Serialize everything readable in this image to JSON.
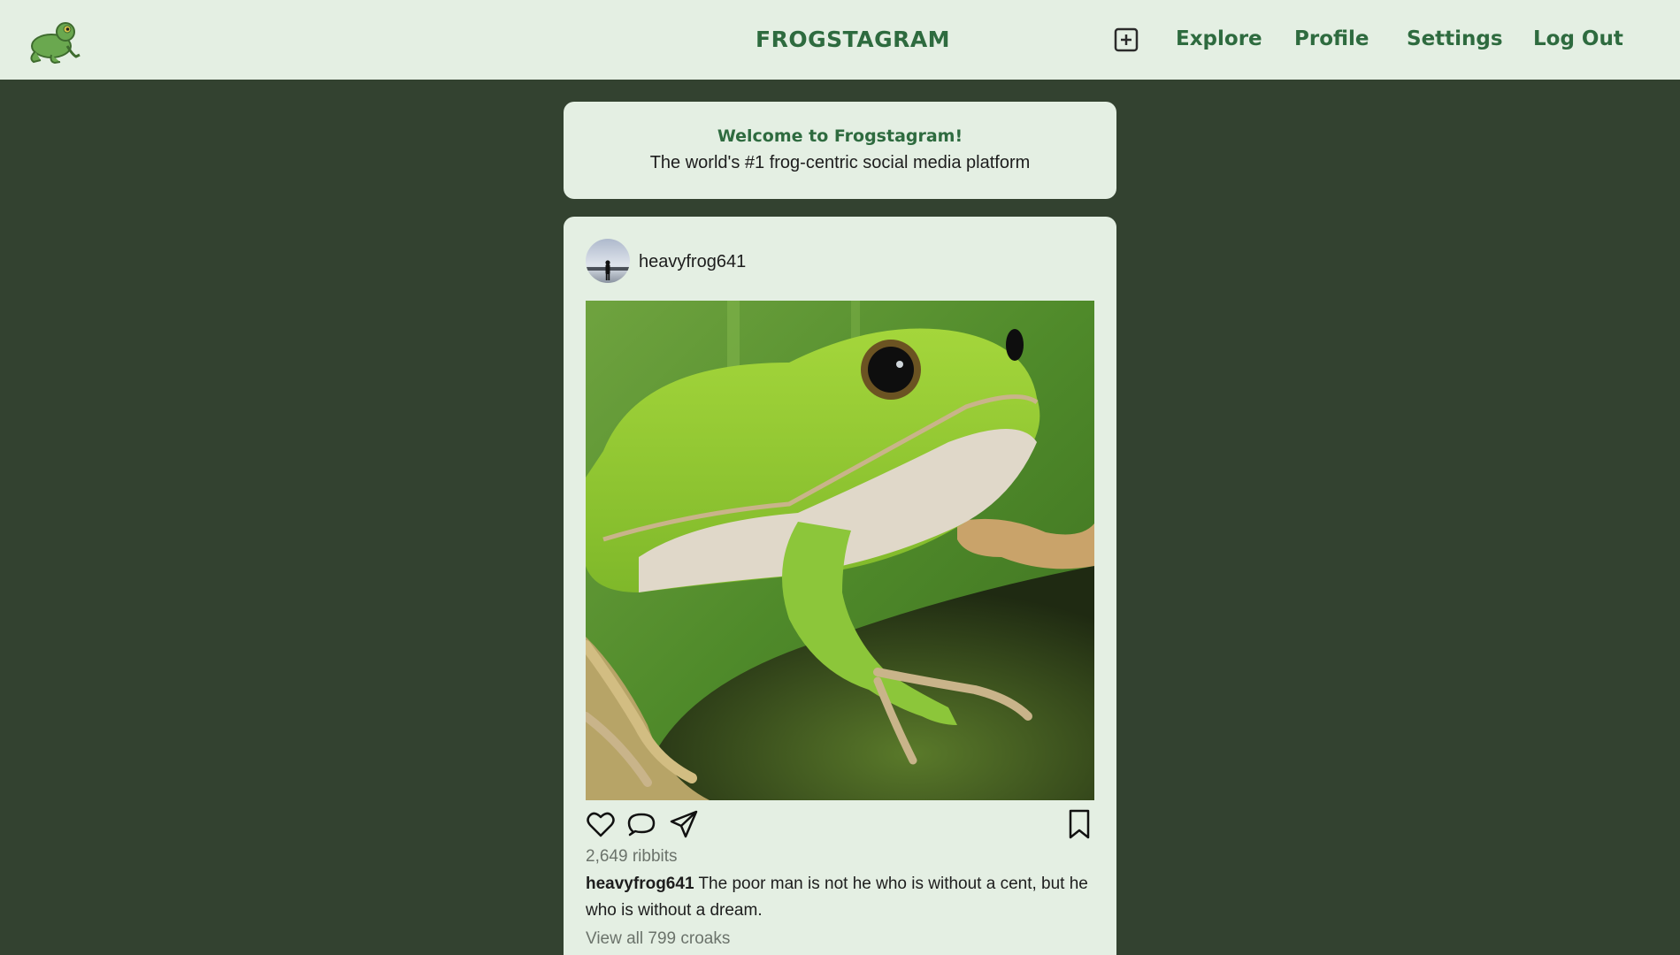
{
  "nav": {
    "brand": "FROGSTAGRAM",
    "logo_icon": "frog-logo-icon",
    "new_post_icon": "plus-square-icon",
    "links": [
      "Explore",
      "Profile",
      "Settings",
      "Log Out"
    ],
    "accent_color": "#2e6b3f",
    "background_color": "#e4efe3"
  },
  "welcome": {
    "title": "Welcome to Frogstagram!",
    "subtitle": "The world's #1 frog-centric social media platform"
  },
  "post": {
    "username": "heavyfrog641",
    "avatar_icon": "avatar-silhouette",
    "image": "green-tree-frog-photo",
    "actions": {
      "like_icon": "heart-icon",
      "comment_icon": "speech-bubble-icon",
      "share_icon": "paper-plane-icon",
      "save_icon": "bookmark-icon"
    },
    "ribbits": "2,649 ribbits",
    "caption_user": "heavyfrog641",
    "caption_text": "The poor man is not he who is without a cent, but he who is without a dream.",
    "view_croaks": "View all 799 croaks"
  },
  "page_background": "#334230"
}
